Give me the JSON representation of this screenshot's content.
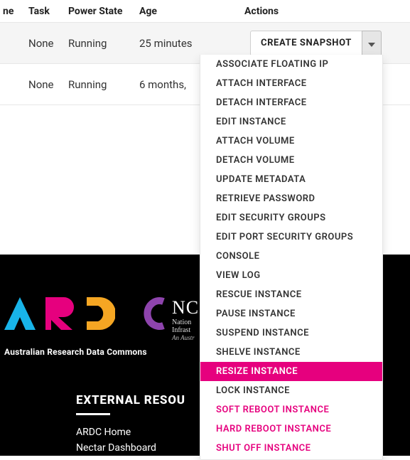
{
  "table": {
    "headers": {
      "ne": "ne",
      "task": "Task",
      "power_state": "Power State",
      "age": "Age",
      "actions": "Actions"
    },
    "rows": [
      {
        "task": "None",
        "power_state": "Running",
        "age": "25 minutes",
        "action_button": "CREATE SNAPSHOT"
      },
      {
        "task": "None",
        "power_state": "Running",
        "age": "6 months,",
        "action_button": ""
      }
    ]
  },
  "dropdown": {
    "items": [
      {
        "label": "ASSOCIATE FLOATING IP",
        "type": "normal"
      },
      {
        "label": "ATTACH INTERFACE",
        "type": "normal"
      },
      {
        "label": "DETACH INTERFACE",
        "type": "normal"
      },
      {
        "label": "EDIT INSTANCE",
        "type": "normal"
      },
      {
        "label": "ATTACH VOLUME",
        "type": "normal"
      },
      {
        "label": "DETACH VOLUME",
        "type": "normal"
      },
      {
        "label": "UPDATE METADATA",
        "type": "normal"
      },
      {
        "label": "RETRIEVE PASSWORD",
        "type": "normal"
      },
      {
        "label": "EDIT SECURITY GROUPS",
        "type": "normal"
      },
      {
        "label": "EDIT PORT SECURITY GROUPS",
        "type": "normal"
      },
      {
        "label": "CONSOLE",
        "type": "normal"
      },
      {
        "label": "VIEW LOG",
        "type": "normal"
      },
      {
        "label": "RESCUE INSTANCE",
        "type": "normal"
      },
      {
        "label": "PAUSE INSTANCE",
        "type": "normal"
      },
      {
        "label": "SUSPEND INSTANCE",
        "type": "normal"
      },
      {
        "label": "SHELVE INSTANCE",
        "type": "normal"
      },
      {
        "label": "RESIZE INSTANCE",
        "type": "highlight"
      },
      {
        "label": "LOCK INSTANCE",
        "type": "normal"
      },
      {
        "label": "SOFT REBOOT INSTANCE",
        "type": "danger"
      },
      {
        "label": "HARD REBOOT INSTANCE",
        "type": "danger"
      },
      {
        "label": "SHUT OFF INSTANCE",
        "type": "danger"
      }
    ]
  },
  "footer": {
    "ardc_subtitle": "Australian Research Data Commons",
    "ncris_big": "NC",
    "ncris_s1": "Nation",
    "ncris_s2": "Infrast",
    "ncris_s3": "An Austr",
    "external_heading": "EXTERNAL RESOU",
    "links": [
      "ARDC Home",
      "Nectar Dashboard"
    ]
  }
}
